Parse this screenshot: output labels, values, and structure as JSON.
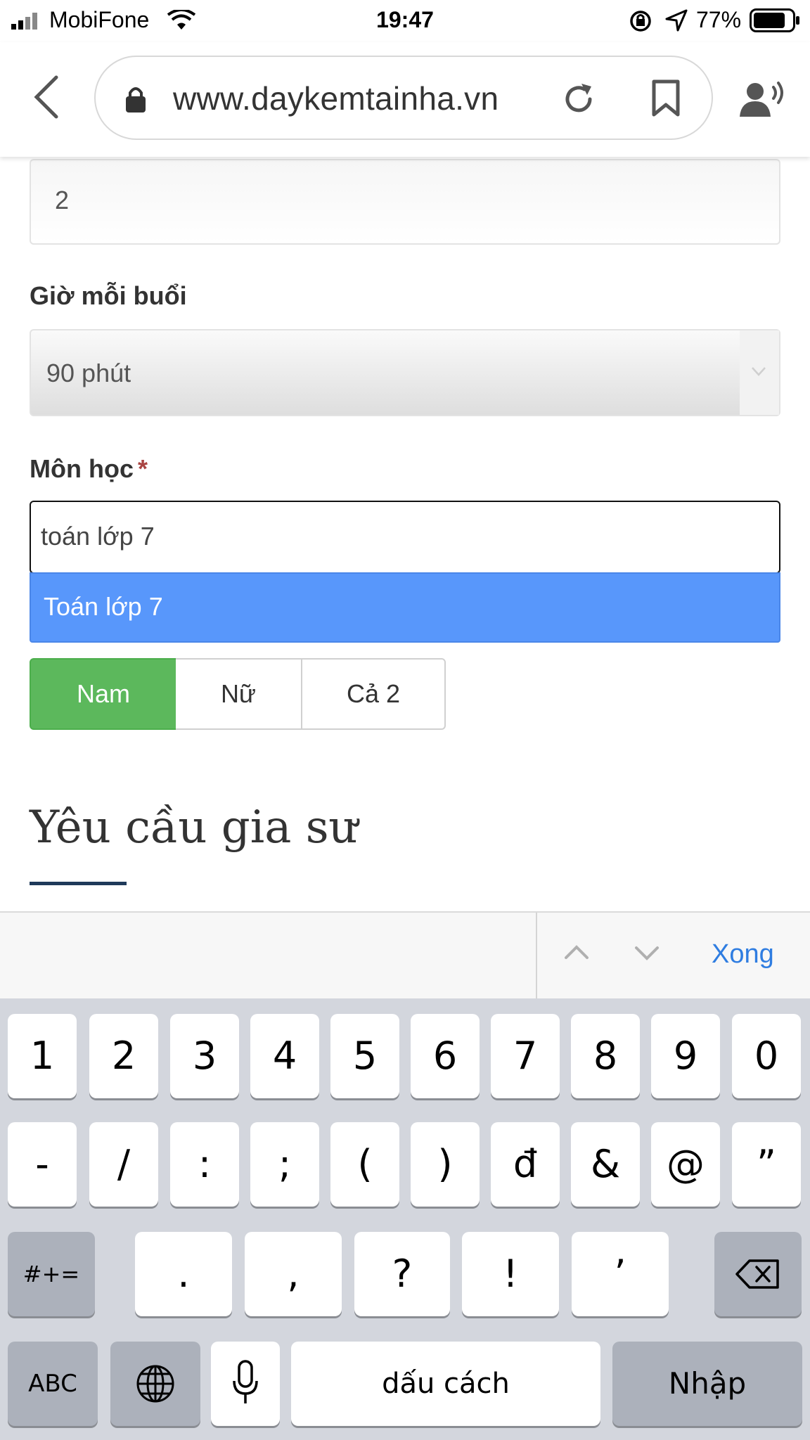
{
  "status_bar": {
    "carrier": "MobiFone",
    "time": "19:47",
    "battery": "77%"
  },
  "browser": {
    "url": "www.daykemtainha.vn"
  },
  "form": {
    "top_field_value": "2",
    "gio_label": "Giờ mỗi buổi",
    "gio_value": "90 phút",
    "mon_label": "Môn học",
    "mon_required": "*",
    "mon_value": "toán lớp 7",
    "suggestion": "Toán lớp 7",
    "gender": {
      "male": "Nam",
      "female": "Nữ",
      "both": "Cả 2",
      "selected": "Nam"
    },
    "section_title": "Yêu cầu gia sư"
  },
  "accessory": {
    "done": "Xong"
  },
  "keyboard": {
    "row1": [
      "1",
      "2",
      "3",
      "4",
      "5",
      "6",
      "7",
      "8",
      "9",
      "0"
    ],
    "row2": [
      "-",
      "/",
      ":",
      ";",
      "(",
      ")",
      "đ",
      "&",
      "@",
      "”"
    ],
    "row3": [
      ".",
      ",",
      "?",
      "!",
      "’"
    ],
    "symbols": "#+=",
    "abc": "ABC",
    "space": "dấu cách",
    "enter": "Nhập"
  },
  "colors": {
    "accent": "#5897fb",
    "selected_green": "#5cb85c",
    "link_blue": "#2f7de1"
  },
  "icons": [
    "signal-icon",
    "wifi-icon",
    "rotation-lock-icon",
    "location-icon",
    "battery-icon",
    "back-icon",
    "lock-icon",
    "reload-icon",
    "bookmark-icon",
    "reader-icon",
    "chevron-down-icon",
    "chevron-up-icon",
    "delete-icon",
    "globe-icon",
    "mic-icon"
  ]
}
